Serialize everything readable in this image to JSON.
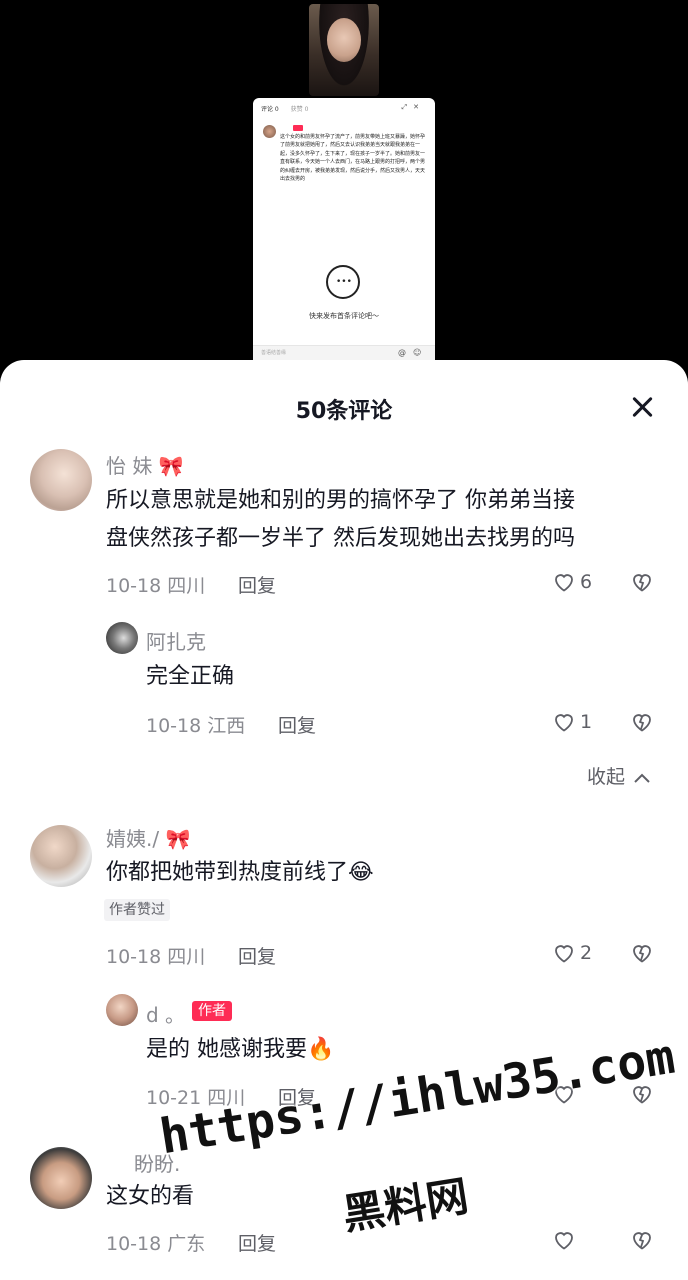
{
  "video": {
    "overlay_tabs": [
      "评论 0",
      "获赞 0"
    ],
    "overlay_text": "这个女的和前男友怀孕了流产了，前男友带她上班又暴躁，她怀孕了前男友就把她甩了，然后又去认识我弟弟当天就跟我弟弟在一起，没多久怀孕了，生下来了，现在孩子一岁半了。她和前男友一直有联系，今天她一个人去西门，在马路上跟男的打招呼，两个男的纠缠去开房，被我弟弟发现，然后说分手，然后又找男人，天天出去找男的",
    "overlay_empty": "快来发布首条评论吧～",
    "overlay_input_placeholder": "善语结善缘"
  },
  "sheet": {
    "title": "50条评论"
  },
  "comments": [
    {
      "username": "怡 妹",
      "text_line1": "所以意思就是她和别的男的搞怀孕了 你弟弟当接",
      "text_line2": "盘侠然孩子都一岁半了 然后发现她出去找男的吗",
      "date_location": "10-18 四川",
      "reply_label": "回复",
      "likes": "6"
    },
    {
      "username": "阿扎克",
      "text": "完全正确",
      "date_location": "10-18 江西",
      "reply_label": "回复",
      "likes": "1"
    },
    {
      "username": "婧姨./",
      "text": "你都把她带到热度前线了",
      "liked_tag": "作者赞过",
      "date_location": "10-18 四川",
      "reply_label": "回复",
      "likes": "2"
    },
    {
      "username": "d 。",
      "author_badge": "作者",
      "text": "是的 她感谢我要",
      "date_location": "10-21 四川",
      "reply_label": "回复",
      "likes": ""
    },
    {
      "username": "盼盼.",
      "text": "这女的看",
      "date_location": "10-18 广东",
      "reply_label": "回复",
      "likes": ""
    }
  ],
  "collapse_label": "收起",
  "watermark": {
    "line1": "https://ihlw35.com",
    "line2": "黑料网"
  },
  "colors": {
    "accent": "#fe2c55",
    "text_primary": "#161823",
    "text_secondary": "#8a8b91"
  }
}
